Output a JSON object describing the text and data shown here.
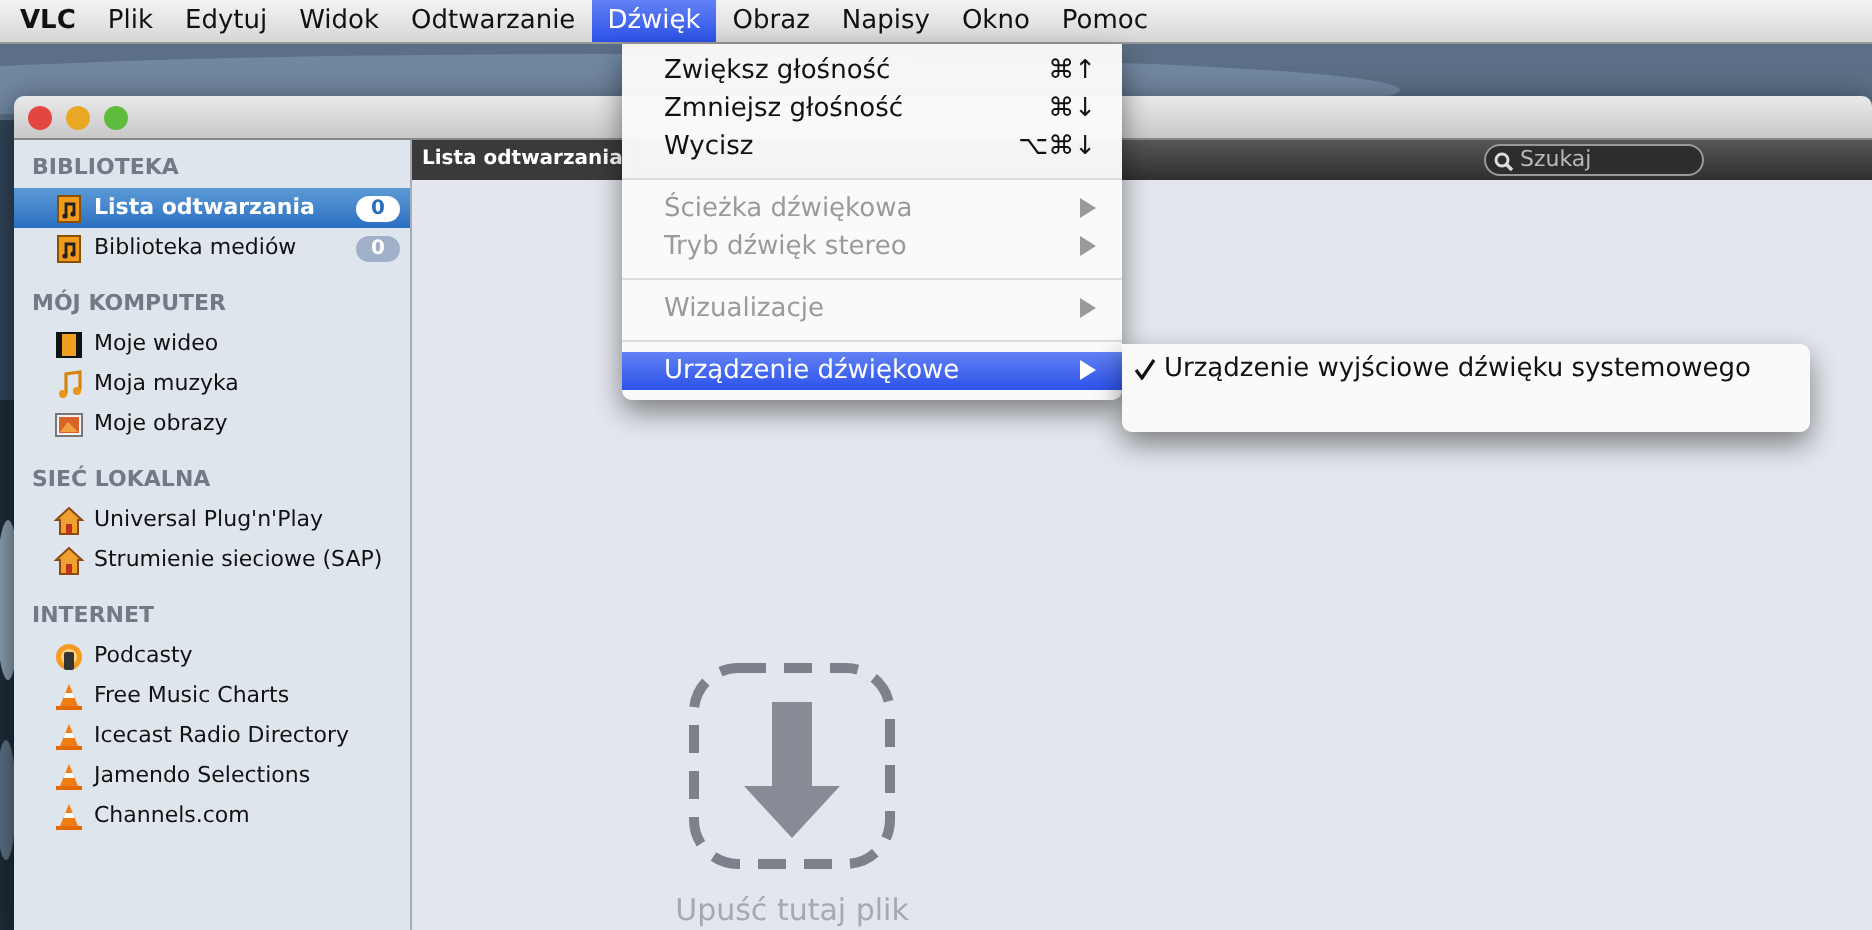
{
  "menubar": [
    {
      "label": "VLC",
      "selected": false,
      "bold": true
    },
    {
      "label": "Plik",
      "selected": false,
      "bold": false
    },
    {
      "label": "Edytuj",
      "selected": false,
      "bold": false
    },
    {
      "label": "Widok",
      "selected": false,
      "bold": false
    },
    {
      "label": "Odtwarzanie",
      "selected": false,
      "bold": false
    },
    {
      "label": "Dźwięk",
      "selected": true,
      "bold": false
    },
    {
      "label": "Obraz",
      "selected": false,
      "bold": false
    },
    {
      "label": "Napisy",
      "selected": false,
      "bold": false
    },
    {
      "label": "Okno",
      "selected": false,
      "bold": false
    },
    {
      "label": "Pomoc",
      "selected": false,
      "bold": false
    }
  ],
  "window": {
    "sidebar": {
      "sections": [
        {
          "title": "BIBLIOTEKA",
          "items": [
            {
              "label": "Lista odtwarzania",
              "kind": "playlist",
              "badge": "0",
              "selected": true
            },
            {
              "label": "Biblioteka mediów",
              "kind": "playlist",
              "badge": "0",
              "selected": false
            }
          ]
        },
        {
          "title": "MÓJ KOMPUTER",
          "items": [
            {
              "label": "Moje wideo",
              "kind": "film",
              "selected": false
            },
            {
              "label": "Moja muzyka",
              "kind": "note",
              "selected": false
            },
            {
              "label": "Moje obrazy",
              "selected": false
            }
          ]
        },
        {
          "title": "SIEĆ LOKALNA",
          "items": [
            {
              "label": "Universal Plug'n'Play",
              "kind": "house",
              "selected": false
            },
            {
              "label": "Strumienie sieciowe (SAP)",
              "kind": "house",
              "selected": false
            }
          ]
        },
        {
          "title": "INTERNET",
          "items": [
            {
              "label": "Podcasty",
              "kind": "podcast",
              "selected": false
            },
            {
              "label": "Free Music Charts",
              "kind": "cone",
              "selected": false
            },
            {
              "label": "Icecast Radio Directory",
              "kind": "cone",
              "selected": false
            },
            {
              "label": "Jamendo Selections",
              "kind": "cone",
              "selected": false
            },
            {
              "label": "Channels.com",
              "kind": "cone",
              "selected": false
            }
          ]
        }
      ]
    },
    "header": {
      "title": "Lista odtwarzania"
    },
    "search": {
      "placeholder": "Szukaj"
    },
    "drop_hint": "Upuść tutaj plik"
  },
  "menu": {
    "items": [
      {
        "kind": "item",
        "label": "Zwiększ głośność",
        "shortcut": "⌘↑",
        "disabled": false,
        "submenu": false,
        "selected": false
      },
      {
        "kind": "item",
        "label": "Zmniejsz głośność",
        "shortcut": "⌘↓",
        "disabled": false,
        "submenu": false,
        "selected": false
      },
      {
        "kind": "item",
        "label": "Wycisz",
        "shortcut": "⌥⌘↓",
        "disabled": false,
        "submenu": false,
        "selected": false
      },
      {
        "kind": "separator"
      },
      {
        "kind": "item",
        "label": "Ścieżka dźwiękowa",
        "disabled": true,
        "submenu": true,
        "selected": false
      },
      {
        "kind": "item",
        "label": "Tryb dźwięk stereo",
        "disabled": true,
        "submenu": true,
        "selected": false
      },
      {
        "kind": "separator"
      },
      {
        "kind": "item",
        "label": "Wizualizacje",
        "disabled": true,
        "submenu": true,
        "selected": false
      },
      {
        "kind": "separator"
      },
      {
        "kind": "item",
        "label": "Urządzenie dźwiękowe",
        "disabled": false,
        "submenu": true,
        "selected": true
      }
    ]
  },
  "submenu": {
    "items": [
      {
        "label": "Urządzenie wyjściowe dźwięku systemowego",
        "checked": true
      }
    ]
  }
}
